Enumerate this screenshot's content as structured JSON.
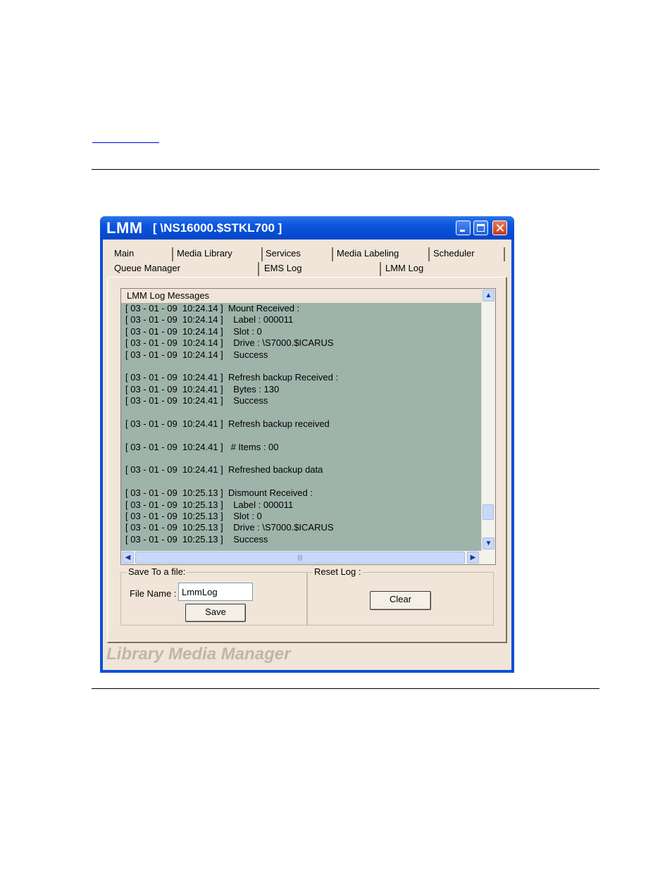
{
  "window": {
    "app_name": "LMM",
    "path": "[ \\NS16000.$STKL700 ]"
  },
  "tabs": {
    "row1": [
      "Main",
      "Media Library",
      "Services",
      "Media Labeling",
      "Scheduler"
    ],
    "row2": [
      "Queue Manager",
      "EMS Log",
      "LMM Log"
    ],
    "selected": "LMM Log"
  },
  "log": {
    "header": "LMM Log Messages",
    "lines": [
      "[ 03 - 01 - 09  10:24.14 ]  Mount Received :",
      "[ 03 - 01 - 09  10:24.14 ]    Label : 000011",
      "[ 03 - 01 - 09  10:24.14 ]    Slot : 0",
      "[ 03 - 01 - 09  10:24.14 ]    Drive : \\S7000.$ICARUS",
      "[ 03 - 01 - 09  10:24.14 ]    Success",
      "",
      "[ 03 - 01 - 09  10:24.41 ]  Refresh backup Received :",
      "[ 03 - 01 - 09  10:24.41 ]    Bytes : 130",
      "[ 03 - 01 - 09  10:24.41 ]    Success",
      "",
      "[ 03 - 01 - 09  10:24.41 ]  Refresh backup received",
      "",
      "[ 03 - 01 - 09  10:24.41 ]   # Items : 00",
      "",
      "[ 03 - 01 - 09  10:24.41 ]  Refreshed backup data",
      "",
      "[ 03 - 01 - 09  10:25.13 ]  Dismount Received :",
      "[ 03 - 01 - 09  10:25.13 ]    Label : 000011",
      "[ 03 - 01 - 09  10:25.13 ]    Slot : 0",
      "[ 03 - 01 - 09  10:25.13 ]    Drive : \\S7000.$ICARUS",
      "[ 03 - 01 - 09  10:25.13 ]    Success"
    ]
  },
  "save_group": {
    "label": "Save To a file:",
    "file_name_label": "File Name :",
    "file_name_value": "LmmLog",
    "save_button": "Save"
  },
  "reset_group": {
    "label": "Reset Log :",
    "clear_button": "Clear"
  },
  "footer_watermark": "Library Media Manager",
  "colors": {
    "titlebar": "#0a55dc",
    "client_bg": "#f0e5d8",
    "log_bg": "#9eb3aa"
  }
}
